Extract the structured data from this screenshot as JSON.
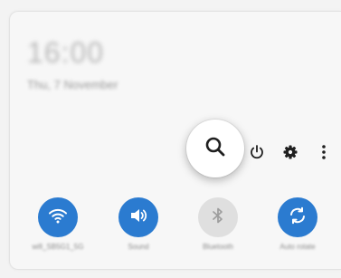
{
  "header": {
    "time": "16:00",
    "date": "Thu, 7 November"
  },
  "actions": {
    "search": "search-icon",
    "power": "power-icon",
    "settings": "gear-icon",
    "more": "more-vertical-icon"
  },
  "tiles": [
    {
      "label": "wifi_SB5G1_5G",
      "icon": "wifi-icon",
      "state": "on"
    },
    {
      "label": "Sound",
      "icon": "sound-icon",
      "state": "on"
    },
    {
      "label": "Bluetooth",
      "icon": "bluetooth-icon",
      "state": "off"
    },
    {
      "label": "Auto rotate",
      "icon": "auto-rotate-icon",
      "state": "on"
    }
  ],
  "colors": {
    "accent": "#2b7bd0",
    "inactive": "#dfdfdf",
    "icon": "#1f1f1f"
  }
}
